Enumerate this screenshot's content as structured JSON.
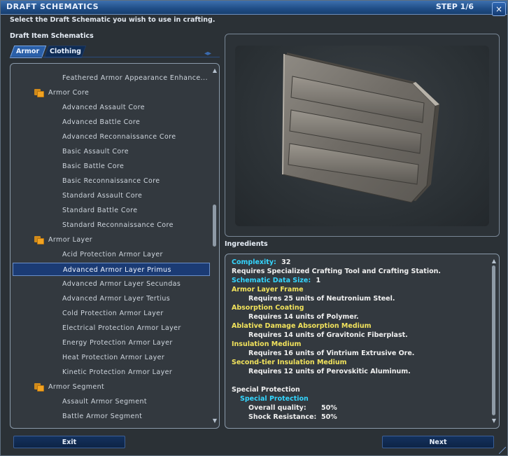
{
  "window": {
    "title": "DRAFT SCHEMATICS",
    "step": "STEP 1/6",
    "close_glyph": "×"
  },
  "instruction": "Select the Draft Schematic you wish to use in crafting.",
  "schematics_label": "Draft Item Schematics",
  "tabs": [
    {
      "label": "Armor",
      "active": true
    },
    {
      "label": "Clothing",
      "active": false
    }
  ],
  "tab_arrows": "◂▸",
  "list": {
    "rows": [
      {
        "type": "item",
        "label": "Feathered Armor Appearance Enhance..."
      },
      {
        "type": "category",
        "label": "Armor Core",
        "icon": "folder-icon"
      },
      {
        "type": "item",
        "label": "Advanced Assault Core"
      },
      {
        "type": "item",
        "label": "Advanced Battle Core"
      },
      {
        "type": "item",
        "label": "Advanced Reconnaissance Core"
      },
      {
        "type": "item",
        "label": "Basic Assault Core"
      },
      {
        "type": "item",
        "label": "Basic Battle Core"
      },
      {
        "type": "item",
        "label": "Basic Reconnaissance Core"
      },
      {
        "type": "item",
        "label": "Standard Assault Core"
      },
      {
        "type": "item",
        "label": "Standard Battle Core"
      },
      {
        "type": "item",
        "label": "Standard Reconnaissance Core"
      },
      {
        "type": "category",
        "label": "Armor Layer",
        "icon": "folder-icon"
      },
      {
        "type": "item",
        "label": "Acid Protection Armor Layer"
      },
      {
        "type": "item",
        "label": "Advanced Armor Layer Primus",
        "selected": true
      },
      {
        "type": "item",
        "label": "Advanced Armor Layer Secundas"
      },
      {
        "type": "item",
        "label": "Advanced Armor Layer Tertius"
      },
      {
        "type": "item",
        "label": "Cold Protection Armor Layer"
      },
      {
        "type": "item",
        "label": "Electrical Protection Armor Layer"
      },
      {
        "type": "item",
        "label": "Energy Protection Armor Layer"
      },
      {
        "type": "item",
        "label": "Heat Protection Armor Layer"
      },
      {
        "type": "item",
        "label": "Kinetic Protection Armor Layer"
      },
      {
        "type": "category",
        "label": "Armor Segment",
        "icon": "folder-icon"
      },
      {
        "type": "item",
        "label": "Assault Armor Segment"
      },
      {
        "type": "item",
        "label": "Battle Armor Segment"
      }
    ],
    "scroll_up": "▲",
    "scroll_down": "▼"
  },
  "ingredients_label": "Ingredients",
  "ingredients": {
    "complexity_label": "Complexity:",
    "complexity_value": "32",
    "requires_tools": "Requires Specialized Crafting Tool and Crafting Station.",
    "data_size_label": "Schematic Data Size:",
    "data_size_value": "1",
    "slots": [
      {
        "name": "Armor Layer Frame",
        "requirement": "Requires 25 units of Neutronium Steel."
      },
      {
        "name": "Absorption Coating",
        "requirement": "Requires 14 units of Polymer."
      },
      {
        "name": "Ablative Damage Absorption Medium",
        "requirement": "Requires 14 units of Gravitonic Fiberplast."
      },
      {
        "name": "Insulation Medium",
        "requirement": "Requires 16 units of Vintrium Extrusive Ore."
      },
      {
        "name": "Second-tier Insulation Medium",
        "requirement": "Requires 12 units of Perovskitic Aluminum."
      }
    ],
    "special_protection_heading": "Special Protection",
    "special_protection_sub": "Special Protection",
    "stats": [
      {
        "label": "Overall quality:",
        "value": "50%"
      },
      {
        "label": "Shock Resistance:",
        "value": "50%"
      }
    ],
    "scroll_up": "▲",
    "scroll_down": "▼"
  },
  "buttons": {
    "exit": "Exit",
    "next": "Next"
  },
  "colors": {
    "accent_blue": "#1f4d86",
    "cyan_label": "#34d6ff",
    "yellow_label": "#f2e35c",
    "folder_orange": "#f2a321"
  }
}
